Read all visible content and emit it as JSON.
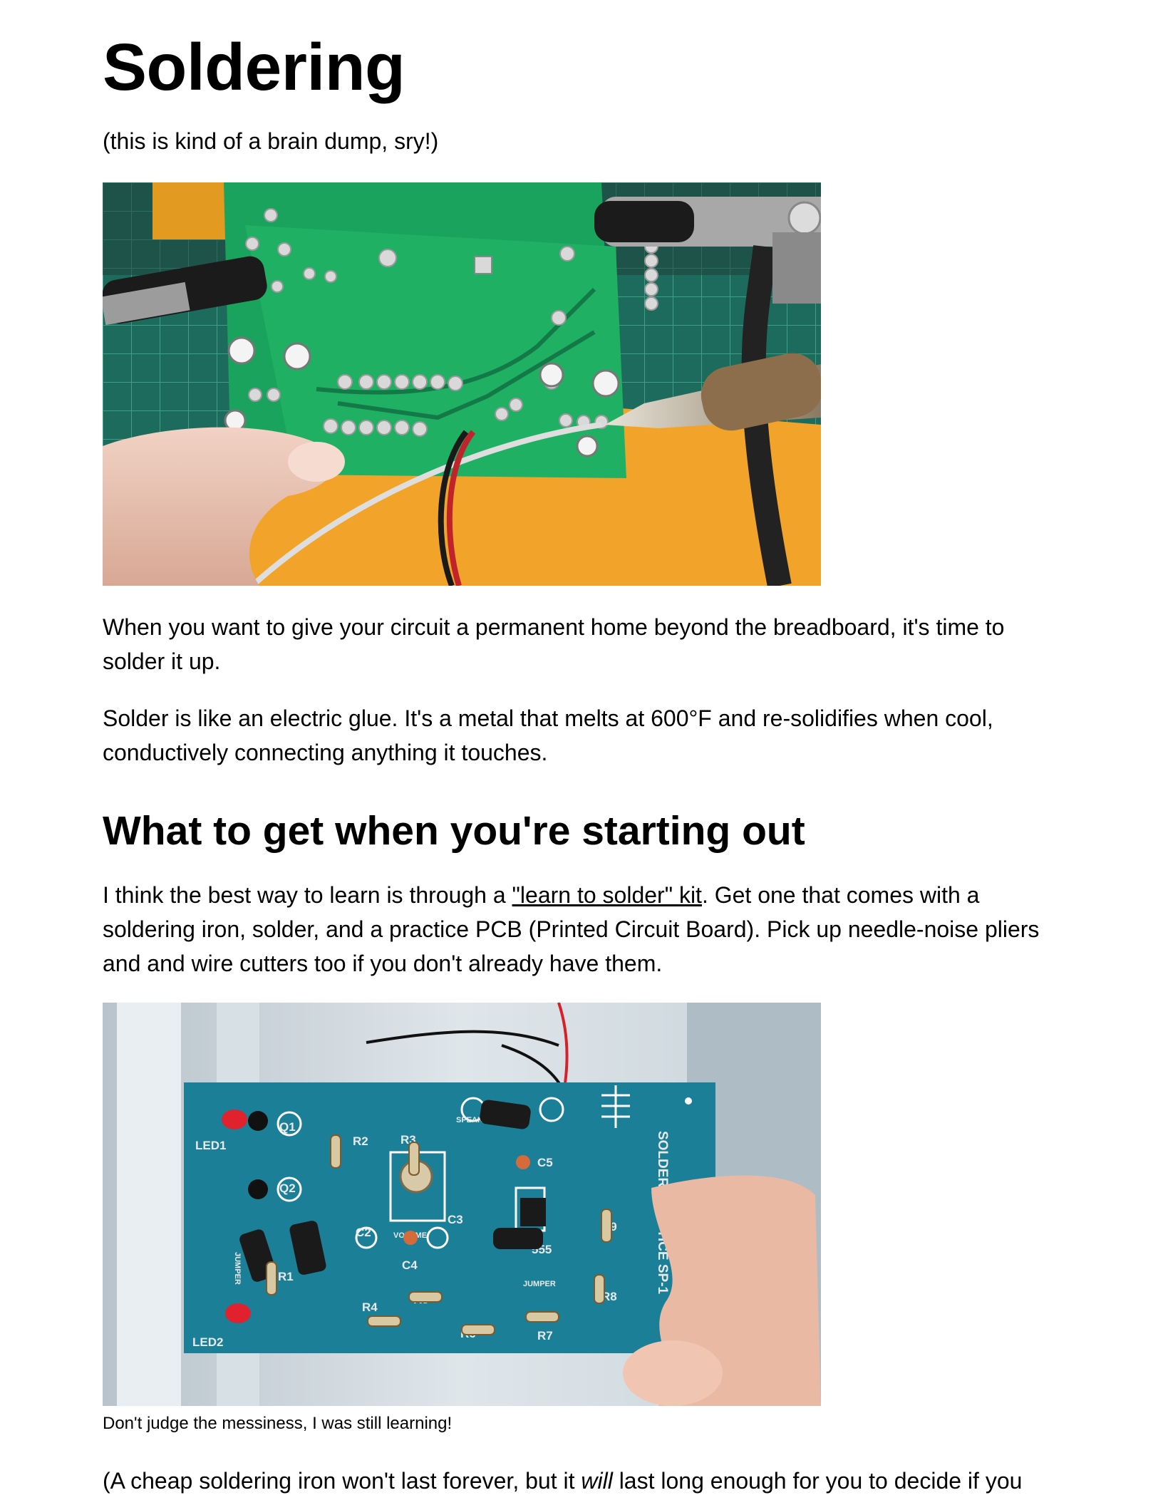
{
  "title": "Soldering",
  "subtitle": "(this is kind of a brain dump, sry!)",
  "intro_para_1": "When you want to give your circuit a permanent home beyond the breadboard, it's time to solder it up.",
  "intro_para_2": "Solder is like an electric glue. It's a metal that melts at 600°F and re-solidifies when cool, conductively connecting anything it touches.",
  "section_heading": "What to get when you're starting out",
  "kit_para": {
    "before": "I think the best way to learn is through a ",
    "link_text": "\"learn to solder\" kit",
    "after": ". Get one that comes with a soldering iron, solder, and a practice PCB (Printed Circuit Board). Pick up needle-noise pliers and and wire cutters too if you don't already have them."
  },
  "photo2": {
    "board_title": "SOLDER PRACTICE SP-1",
    "labels": [
      "LED1",
      "Q1",
      "R2",
      "R3",
      "Q2",
      "C2",
      "VOLUME",
      "C3",
      "C5",
      "R9",
      "JUMPER",
      "R1",
      "C4",
      "R5",
      "R4",
      "R6",
      "R7",
      "R8",
      "LED2",
      "SPEAKER",
      "555",
      "JUMPER"
    ]
  },
  "caption": "Don't judge the messiness, I was still learning!",
  "closing_para": {
    "before": "(A cheap soldering iron won't last forever, but it ",
    "emphasis": "will",
    "after": " last long enough for you to decide if you"
  },
  "colors": {
    "pcb_green": "#1aa35d",
    "pcb_blue": "#1a7f97",
    "mat_orange": "#f2a42a",
    "text": "#000000"
  }
}
